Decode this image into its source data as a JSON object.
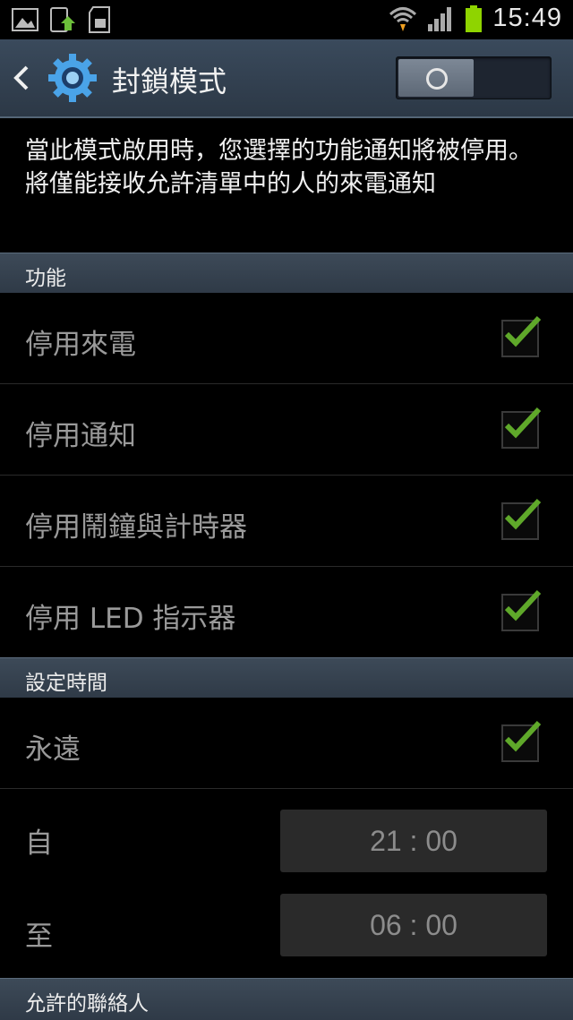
{
  "status_bar": {
    "time": "15:49",
    "icons_left": [
      "gallery-icon",
      "app-update-icon",
      "sd-card-icon"
    ],
    "icons_right": [
      "wifi-icon",
      "signal-icon",
      "battery-icon"
    ],
    "battery_color": "#8fd400"
  },
  "action_bar": {
    "title": "封鎖模式",
    "toggle_state": "off"
  },
  "description": "當此模式啟用時，您選擇的功能通知將被停用。將僅能接收允許清單中的人的來電通知",
  "sections": {
    "features": {
      "header": "功能"
    },
    "schedule": {
      "header": "設定時間"
    },
    "contacts": {
      "header": "允許的聯絡人"
    }
  },
  "features": [
    {
      "label": "停用來電",
      "checked": true
    },
    {
      "label": "停用通知",
      "checked": true
    },
    {
      "label": "停用鬧鐘與計時器",
      "checked": true
    },
    {
      "label": "停用 LED 指示器",
      "checked": true
    }
  ],
  "schedule": {
    "always_label": "永遠",
    "always_checked": true,
    "from_label": "自",
    "from_time": "21 : 00",
    "to_label": "至",
    "to_time": "06 : 00"
  },
  "colors": {
    "check": "#5fa82a",
    "header_bg": "#36424f"
  }
}
